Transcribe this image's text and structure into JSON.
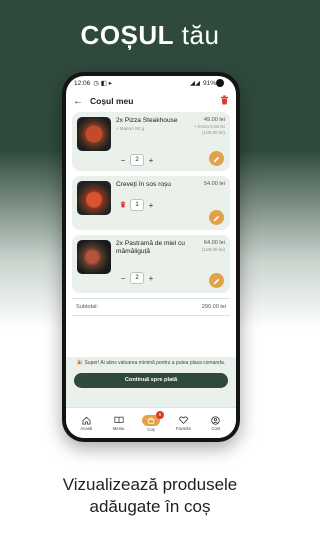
{
  "promo": {
    "title_bold": "COȘUL",
    "title_rest": "tău",
    "caption_line1": "Vizualizează produsele",
    "caption_line2": "adăugate în coș"
  },
  "statusbar": {
    "time": "12:06",
    "battery": "91%"
  },
  "appbar": {
    "title": "Coșul meu"
  },
  "cart_items": [
    {
      "qty_label": "2x",
      "name": "Pizza Steakhouse",
      "extra": "+ Bacon 50 g",
      "price": "49.00 lei",
      "extra_price": "+ Extra 5.00 lei",
      "total": "(108.00 lei)",
      "quantity": "2"
    },
    {
      "qty_label": "",
      "name": "Creveți în sos roșu",
      "price": "54.00 lei",
      "quantity": "1"
    },
    {
      "qty_label": "2x",
      "name": "Pastramă de miel cu mămăliguță",
      "price": "64.00 lei",
      "total": "(128.00 lei)",
      "quantity": "2"
    }
  ],
  "subtotal": {
    "label": "Subtotal:",
    "value": "290.00 lei"
  },
  "notice": {
    "text": "🎉 Super! Ai atins valoarea minimă pentru a putea plasa comanda."
  },
  "cta": {
    "label": "Continuă spre plată"
  },
  "nav": {
    "items": [
      {
        "label": "Acasă"
      },
      {
        "label": "Meniu"
      },
      {
        "label": "Coș",
        "badge": "5"
      },
      {
        "label": "Favorite"
      },
      {
        "label": "Cont"
      }
    ]
  },
  "colors": {
    "brand_dark": "#2f4a3d",
    "accent": "#e3a148",
    "danger": "#d93a2e",
    "card_bg": "#e9f1ea"
  }
}
